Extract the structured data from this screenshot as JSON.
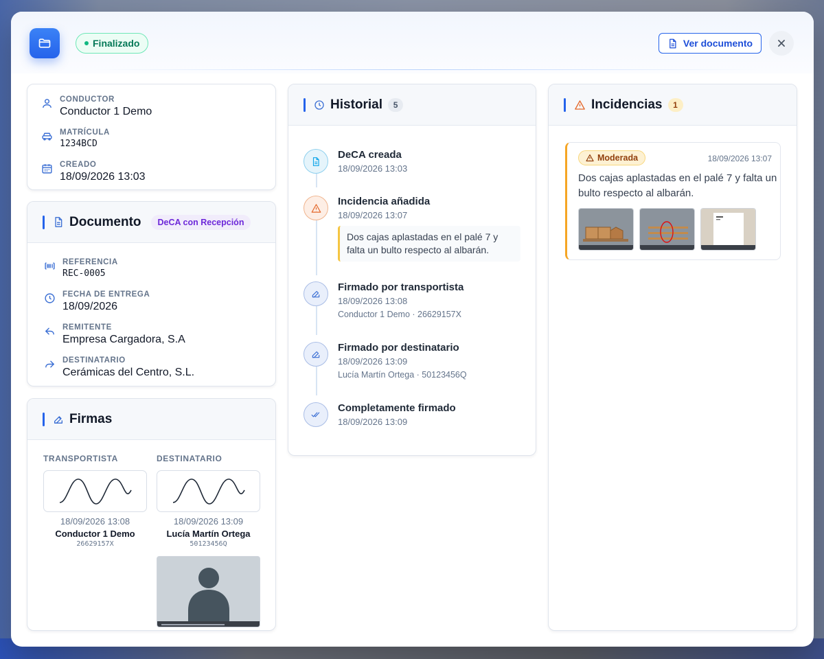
{
  "header": {
    "status": "Finalizado",
    "view_document": "Ver documento"
  },
  "info": {
    "driver_label": "CONDUCTOR",
    "driver_value": "Conductor 1 Demo",
    "plate_label": "MATRÍCULA",
    "plate_value": "1234BCD",
    "created_label": "CREADO",
    "created_value": "18/09/2026 13:03"
  },
  "document": {
    "title": "Documento",
    "type": "DeCA con Recepción",
    "reference_label": "REFERENCIA",
    "reference_value": "REC-0005",
    "delivery_label": "FECHA DE ENTREGA",
    "delivery_value": "18/09/2026",
    "sender_label": "REMITENTE",
    "sender_value": "Empresa Cargadora, S.A",
    "recipient_label": "DESTINATARIO",
    "recipient_value": "Cerámicas del Centro, S.L."
  },
  "signatures": {
    "title": "Firmas",
    "carrier": {
      "heading": "TRANSPORTISTA",
      "date": "18/09/2026 13:08",
      "name": "Conductor 1 Demo",
      "id": "26629157X"
    },
    "recipient": {
      "heading": "DESTINATARIO",
      "date": "18/09/2026 13:09",
      "name": "Lucía Martín Ortega",
      "id": "50123456Q"
    }
  },
  "history": {
    "title": "Historial",
    "count": "5",
    "events": [
      {
        "title": "DeCA creada",
        "date": "18/09/2026 13:03",
        "icon": "document-icon"
      },
      {
        "title": "Incidencia añadida",
        "date": "18/09/2026 13:07",
        "note": "Dos cajas aplastadas en el palé 7 y falta un bulto respecto al albarán.",
        "icon": "warning-icon"
      },
      {
        "title": "Firmado por transportista",
        "date": "18/09/2026 13:08",
        "extra": "Conductor 1 Demo · 26629157X",
        "icon": "edit-icon"
      },
      {
        "title": "Firmado por destinatario",
        "date": "18/09/2026 13:09",
        "extra": "Lucía Martín Ortega · 50123456Q",
        "icon": "edit-icon"
      },
      {
        "title": "Completamente firmado",
        "date": "18/09/2026 13:09",
        "icon": "double-check-icon"
      }
    ]
  },
  "incidents": {
    "title": "Incidencias",
    "count": "1",
    "items": [
      {
        "severity": "Moderada",
        "date": "18/09/2026 13:07",
        "description": "Dos cajas aplastadas en el palé 7 y falta un bulto respecto al albarán."
      }
    ]
  },
  "colors": {
    "primary": "#2563eb",
    "success": "#10b981",
    "warning": "#f5a524",
    "purple": "#6d28d9"
  }
}
